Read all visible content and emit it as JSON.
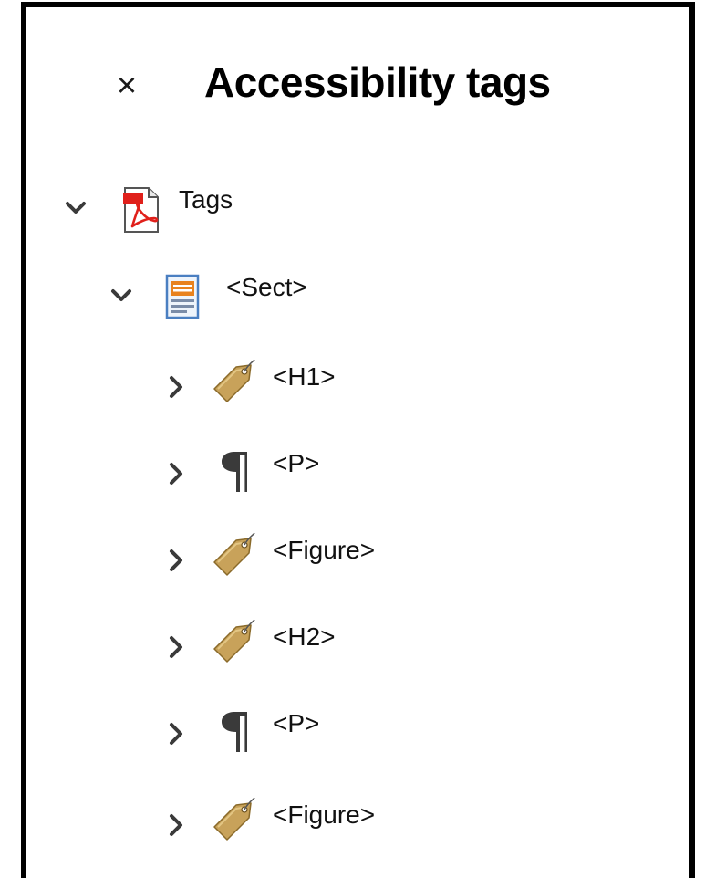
{
  "panel": {
    "title": "Accessibility tags",
    "close_icon": "close-icon",
    "close_glyph": "×"
  },
  "tree": {
    "root": {
      "label": "Tags",
      "icon": "pdf-document-icon",
      "expanded": true
    },
    "section": {
      "label": "<Sect>",
      "icon": "section-icon",
      "expanded": true
    },
    "children": [
      {
        "label": "<H1>",
        "icon": "tag-icon",
        "expanded": false
      },
      {
        "label": "<P>",
        "icon": "paragraph-icon",
        "expanded": false
      },
      {
        "label": "<Figure>",
        "icon": "tag-icon",
        "expanded": false
      },
      {
        "label": "<H2>",
        "icon": "tag-icon",
        "expanded": false
      },
      {
        "label": "<P>",
        "icon": "paragraph-icon",
        "expanded": false
      },
      {
        "label": "<Figure>",
        "icon": "tag-icon",
        "expanded": false
      }
    ]
  },
  "colors": {
    "border": "#000000",
    "chevron": "#3a3a3a",
    "tag_fill": "#c8a25a",
    "pdf_red": "#e0201b",
    "section_orange": "#e8821e",
    "section_blue": "#4a7fc1"
  }
}
